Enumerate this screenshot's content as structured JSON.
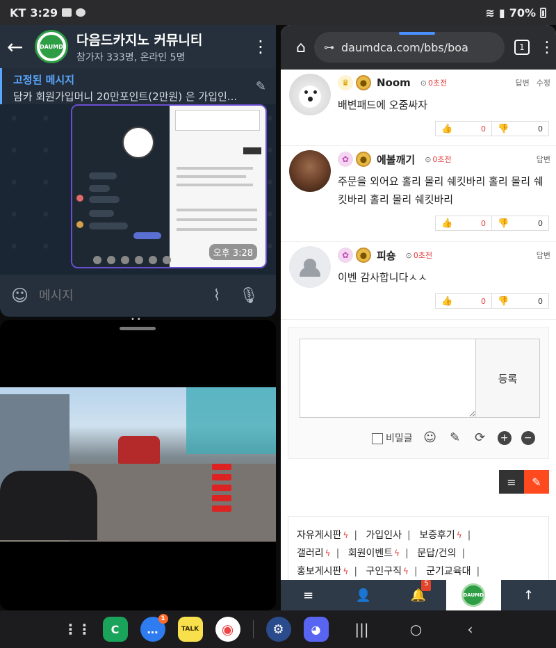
{
  "status_bar": {
    "carrier": "KT",
    "time": "3:29",
    "battery": "70%"
  },
  "telegram": {
    "title": "다음드카지노 커뮤니티",
    "subtitle": "참가자 333명, 온라인 5명",
    "avatar_text": "DAUMD",
    "pinned_title": "고정된 메시지",
    "pinned_text": "담카 회원가입머니 20만포인트(2만원) 은 가입인...",
    "shot_time": "오후 3:28",
    "input_placeholder": "메시지"
  },
  "browser": {
    "url": "daumdca.com/bbs/boa",
    "tab_count": "1",
    "comments": [
      {
        "name": "Noom",
        "time": "0초전",
        "actions": [
          "답변",
          "수정"
        ],
        "text": "배변패드에 오줌싸자",
        "up": "0",
        "down": "0"
      },
      {
        "name": "에볼깨기",
        "time": "0초전",
        "actions": [
          "답변"
        ],
        "text": "주문을 외어요 홀리 몰리 쉐킷바리 홀리 몰리 쉐킷바리 홀리 몰리 쉐킷바리",
        "up": "0",
        "down": "0"
      },
      {
        "name": "피숑",
        "time": "0초전",
        "actions": [
          "답변"
        ],
        "text": "이벤 감사합니다ㅅㅅ",
        "up": "0",
        "down": "0"
      }
    ],
    "reply_form": {
      "submit_label": "등록",
      "secret_label": "비밀글"
    },
    "board_links": [
      {
        "label": "자유게시판",
        "hot": true
      },
      {
        "label": "가입인사",
        "hot": false
      },
      {
        "label": "보증후기",
        "hot": true
      },
      {
        "label": "갤러리",
        "hot": true
      },
      {
        "label": "회원이벤트",
        "hot": true
      },
      {
        "label": "문답/건의",
        "hot": false
      },
      {
        "label": "홍보게시판",
        "hot": true
      },
      {
        "label": "구인구직",
        "hot": true
      },
      {
        "label": "군기교육대",
        "hot": false
      }
    ],
    "bottom_nav": {
      "notification_count": "5",
      "logo_text": "DAUMD"
    }
  },
  "dock": {
    "messages_badge": "1",
    "kakao_label": "TALK"
  },
  "colors": {
    "accent_red": "#e23c3c",
    "write_orange": "#ff4a1f",
    "nav_bg": "#2f3a49",
    "telegram_blue": "#5aa7ff"
  }
}
